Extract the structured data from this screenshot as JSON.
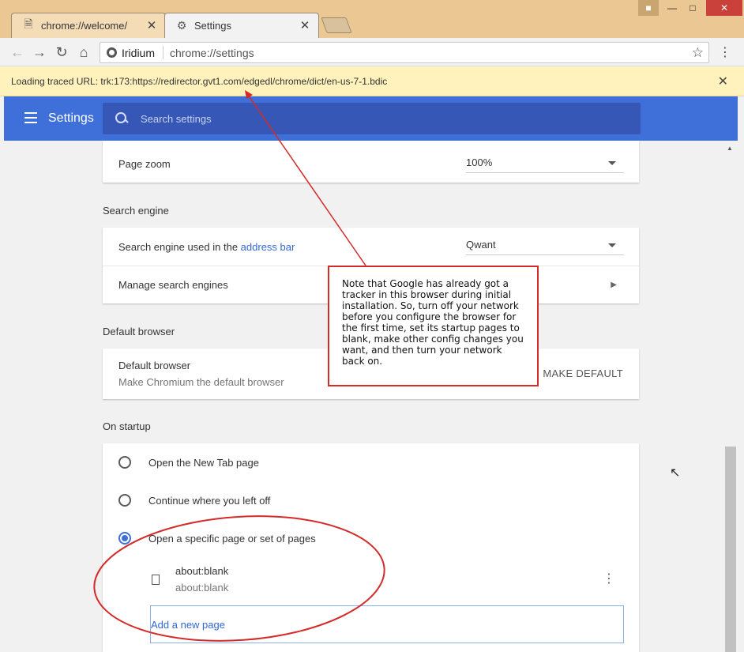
{
  "tabs": [
    {
      "title": "chrome://welcome/",
      "icon": "page-icon",
      "active": false
    },
    {
      "title": "Settings",
      "icon": "gear-icon",
      "active": true
    }
  ],
  "toolbar": {
    "site_name": "Iridium",
    "url": "chrome://settings"
  },
  "loading_bar": {
    "text": "Loading traced URL: trk:173:https://redirector.gvt1.com/edgedl/chrome/dict/en-us-7-1.bdic"
  },
  "header": {
    "title": "Settings",
    "search_placeholder": "Search settings"
  },
  "appearance": {
    "page_zoom_label": "Page zoom",
    "page_zoom_value": "100%"
  },
  "search_engine": {
    "section_title": "Search engine",
    "used_in_prefix": "Search engine used in the ",
    "used_in_link": "address bar",
    "value": "Qwant",
    "manage_label": "Manage search engines"
  },
  "default_browser": {
    "section_title": "Default browser",
    "label": "Default browser",
    "sublabel": "Make Chromium the default browser",
    "button": "MAKE DEFAULT"
  },
  "on_startup": {
    "section_title": "On startup",
    "options": [
      {
        "label": "Open the New Tab page",
        "checked": false
      },
      {
        "label": "Continue where you left off",
        "checked": false
      },
      {
        "label": "Open a specific page or set of pages",
        "checked": true
      }
    ],
    "page_entry": {
      "title": "about:blank",
      "url": "about:blank"
    },
    "add_page_label": "Add a new page"
  },
  "annotation": {
    "note": "Note that Google has already got a tracker in this browser during initial installation. So, turn off your network before you configure the browser for the first time, set its startup pages to blank, make other config changes you want, and then turn your network back on."
  },
  "colors": {
    "header_blue": "#3f6fd8",
    "annotation_red": "#d42a2a",
    "loading_bar_yellow": "#fff2bd"
  }
}
